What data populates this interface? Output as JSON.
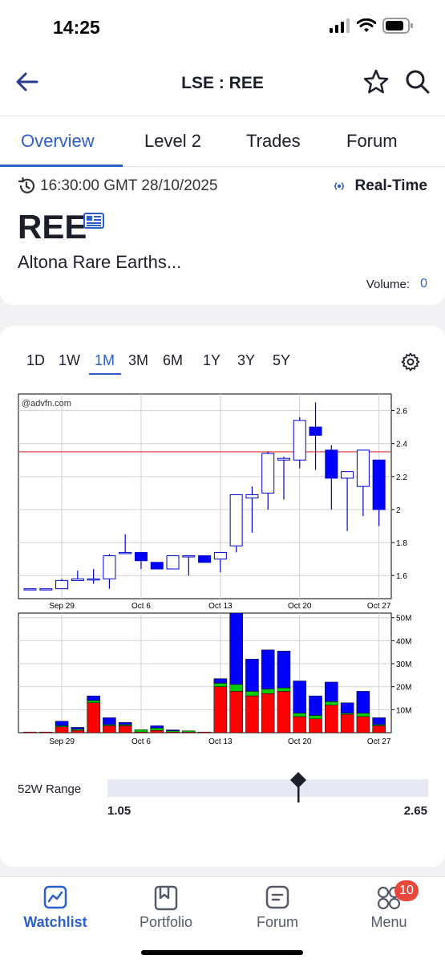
{
  "status_bar": {
    "time": "14:25"
  },
  "header": {
    "title": "LSE : REE"
  },
  "tabs": [
    "Overview",
    "Level 2",
    "Trades",
    "Forum"
  ],
  "active_tab": "Overview",
  "quote": {
    "timestamp": "16:30:00 GMT 28/10/2025",
    "realtime_label": "Real-Time",
    "symbol": "REE",
    "company_name": "Altona Rare Earths...",
    "volume_label": "Volume:",
    "volume_value": "0"
  },
  "ranges": [
    "1D",
    "1W",
    "1M",
    "3M",
    "6M",
    "1Y",
    "3Y",
    "5Y"
  ],
  "active_range": "1M",
  "chart_data": [
    {
      "type": "candlestick",
      "watermark": "@advfn.com",
      "x_tick_labels": [
        "Sep 29",
        "Oct 6",
        "Oct 13",
        "Oct 20",
        "Oct 27"
      ],
      "y_tick_labels": [
        "1.6",
        "1.8",
        "2",
        "2.2",
        "2.4",
        "2.6"
      ],
      "ylim": [
        1.46,
        2.7
      ],
      "reference_line": 2.35,
      "reference_line_color": "#e04040",
      "up_color": "#ffffff",
      "down_color": "#0000ff",
      "candles": [
        {
          "date": "Sep 25",
          "open": 1.52,
          "high": 1.52,
          "low": 1.52,
          "close": 1.52
        },
        {
          "date": "Sep 26",
          "open": 1.52,
          "high": 1.52,
          "low": 1.52,
          "close": 1.52
        },
        {
          "date": "Sep 29",
          "open": 1.52,
          "high": 1.58,
          "low": 1.52,
          "close": 1.57
        },
        {
          "date": "Sep 30",
          "open": 1.57,
          "high": 1.63,
          "low": 1.57,
          "close": 1.58
        },
        {
          "date": "Oct 1",
          "open": 1.58,
          "high": 1.64,
          "low": 1.55,
          "close": 1.58
        },
        {
          "date": "Oct 2",
          "open": 1.58,
          "high": 1.73,
          "low": 1.52,
          "close": 1.72
        },
        {
          "date": "Oct 3",
          "open": 1.74,
          "high": 1.85,
          "low": 1.74,
          "close": 1.74
        },
        {
          "date": "Oct 6",
          "open": 1.74,
          "high": 1.74,
          "low": 1.64,
          "close": 1.69
        },
        {
          "date": "Oct 7",
          "open": 1.68,
          "high": 1.68,
          "low": 1.64,
          "close": 1.64
        },
        {
          "date": "Oct 8",
          "open": 1.64,
          "high": 1.72,
          "low": 1.64,
          "close": 1.72
        },
        {
          "date": "Oct 9",
          "open": 1.72,
          "high": 1.72,
          "low": 1.6,
          "close": 1.72
        },
        {
          "date": "Oct 10",
          "open": 1.72,
          "high": 1.72,
          "low": 1.68,
          "close": 1.68
        },
        {
          "date": "Oct 13",
          "open": 1.7,
          "high": 1.74,
          "low": 1.62,
          "close": 1.74
        },
        {
          "date": "Oct 14",
          "open": 1.78,
          "high": 2.09,
          "low": 1.74,
          "close": 2.09
        },
        {
          "date": "Oct 15",
          "open": 2.07,
          "high": 2.14,
          "low": 1.86,
          "close": 2.09
        },
        {
          "date": "Oct 16",
          "open": 2.1,
          "high": 2.35,
          "low": 2.0,
          "close": 2.34
        },
        {
          "date": "Oct 17",
          "open": 2.3,
          "high": 2.32,
          "low": 2.06,
          "close": 2.31
        },
        {
          "date": "Oct 20",
          "open": 2.3,
          "high": 2.56,
          "low": 2.25,
          "close": 2.54
        },
        {
          "date": "Oct 21",
          "open": 2.5,
          "high": 2.65,
          "low": 2.24,
          "close": 2.45
        },
        {
          "date": "Oct 22",
          "open": 2.36,
          "high": 2.39,
          "low": 2.0,
          "close": 2.19
        },
        {
          "date": "Oct 23",
          "open": 2.19,
          "high": 2.23,
          "low": 1.87,
          "close": 2.23
        },
        {
          "date": "Oct 24",
          "open": 2.14,
          "high": 2.36,
          "low": 1.96,
          "close": 2.36
        },
        {
          "date": "Oct 27",
          "open": 2.3,
          "high": 2.3,
          "low": 1.9,
          "close": 2.0
        }
      ]
    },
    {
      "type": "bar",
      "stacked": true,
      "x_tick_labels": [
        "Sep 29",
        "Oct 6",
        "Oct 13",
        "Oct 20",
        "Oct 27"
      ],
      "y_tick_labels": [
        "10M",
        "20M",
        "30M",
        "40M",
        "50M"
      ],
      "ylim": [
        0,
        52
      ],
      "series": [
        {
          "color": "#ff0000",
          "values": [
            0.3,
            0.3,
            2.5,
            1.0,
            13.0,
            3.0,
            3.0,
            0.3,
            1.0,
            0.3,
            0.3,
            0.3,
            20.0,
            18.0,
            16.0,
            17.0,
            18.0,
            7.0,
            6.0,
            12.0,
            8.0,
            7.0,
            3.0
          ]
        },
        {
          "color": "#00cc00",
          "values": [
            0,
            0,
            0.5,
            0.5,
            1.0,
            0.5,
            0.5,
            1.0,
            1.0,
            0.5,
            0.5,
            0,
            1.5,
            3.0,
            2.0,
            2.0,
            1.5,
            1.5,
            1.5,
            1.5,
            0.5,
            1.5,
            0.5
          ]
        },
        {
          "color": "#0000ff",
          "values": [
            0,
            0,
            2.0,
            0.8,
            2.0,
            3.0,
            1.0,
            0,
            1.0,
            0.4,
            0,
            0,
            2.0,
            31.0,
            14.0,
            17.0,
            16.0,
            14.0,
            8.5,
            8.5,
            4.5,
            9.5,
            3.0
          ]
        }
      ]
    }
  ],
  "range_52w": {
    "label": "52W Range",
    "low": "1.05",
    "high": "2.65",
    "current_fraction": 0.595
  },
  "bottom_nav": [
    {
      "label": "Watchlist"
    },
    {
      "label": "Portfolio"
    },
    {
      "label": "Forum"
    },
    {
      "label": "Menu",
      "badge": "10"
    }
  ],
  "colors": {
    "accent": "#2c5fc9",
    "badge": "#e8473d"
  }
}
